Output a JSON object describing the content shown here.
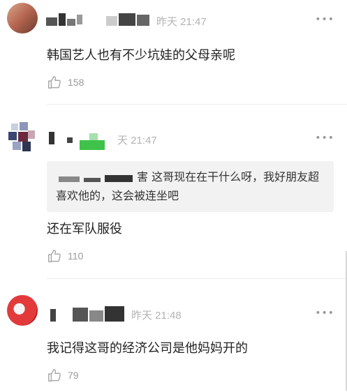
{
  "comments": [
    {
      "time": "昨天 21:47",
      "more": "•••",
      "content": "韩国艺人也有不少坑娃的父母亲呢",
      "likes": "158"
    },
    {
      "time": "天 21:47",
      "more": "•••",
      "quote": "害 这哥现在在干什么呀，我好朋友超喜欢他的，这会被连坐吧",
      "content": "还在军队服役",
      "likes": "110"
    },
    {
      "time": "昨天 21:48",
      "more": "•••",
      "content": "我记得这哥的经济公司是他妈妈开的",
      "likes": "79"
    }
  ],
  "icons": {
    "like": "thumbs-up-icon",
    "more": "more-icon",
    "avatar": "avatar"
  },
  "colors": {
    "time": "#b3b3b3",
    "divider": "#ededed",
    "quote_bg": "#f2f2f2"
  }
}
